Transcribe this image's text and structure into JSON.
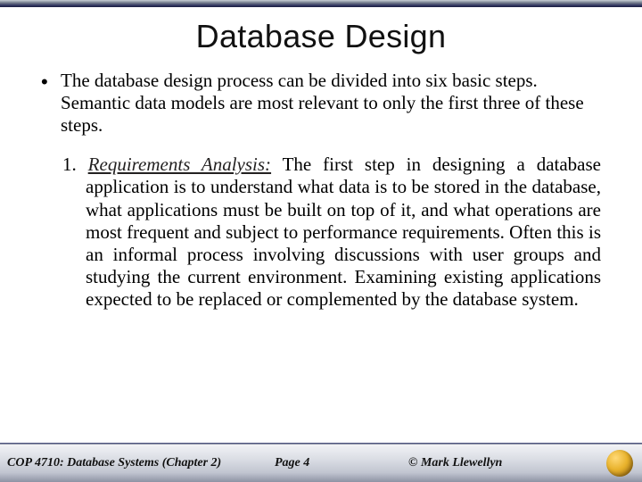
{
  "title": "Database Design",
  "intro": "The database design process can be divided into six basic steps.  Semantic data models are most relevant to only the first three of these steps.",
  "step1_num": "1. ",
  "step1_heading": "Requirements Analysis:",
  "step1_body": " The first step in designing a database application is to understand what data is to be stored in the database, what applications must be built on top of it, and what operations are most frequent and subject to performance requirements.  Often this is an informal process involving discussions with user groups and studying the current environment.  Examining existing applications expected to be replaced or complemented by the database system.",
  "footer": {
    "left": "COP 4710: Database Systems  (Chapter 2)",
    "page": "Page 4",
    "author": "© Mark Llewellyn"
  }
}
